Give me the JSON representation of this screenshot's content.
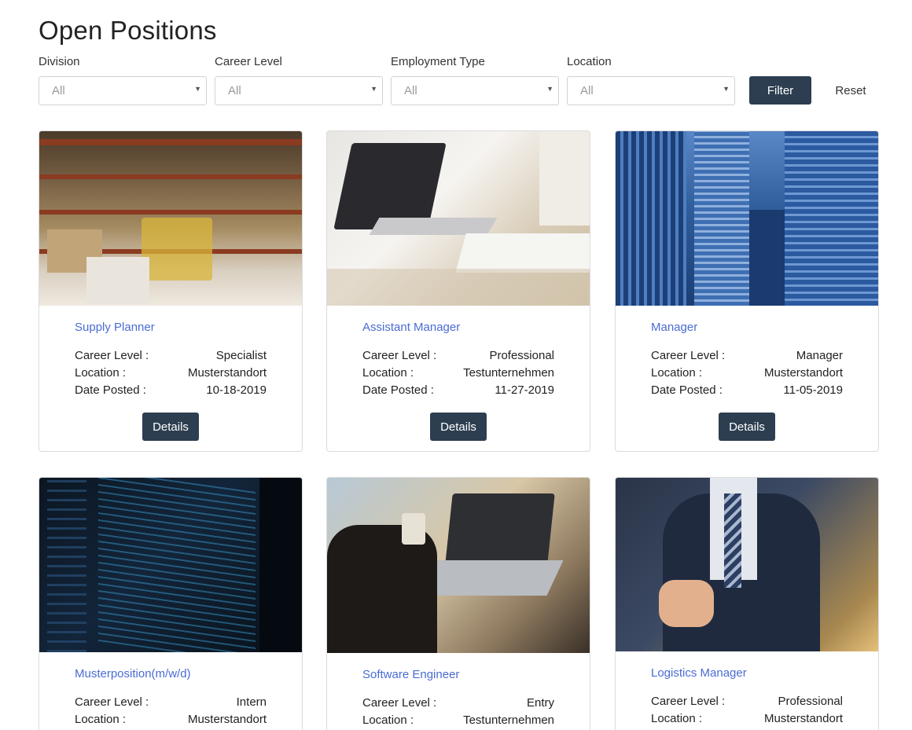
{
  "page_title": "Open Positions",
  "filters": [
    {
      "label": "Division",
      "value": "All"
    },
    {
      "label": "Career Level",
      "value": "All"
    },
    {
      "label": "Employment Type",
      "value": "All"
    },
    {
      "label": "Location",
      "value": "All"
    }
  ],
  "buttons": {
    "filter": "Filter",
    "reset": "Reset",
    "details": "Details"
  },
  "field_labels": {
    "career_level": "Career Level :",
    "location": "Location :",
    "date_posted": "Date Posted :"
  },
  "jobs": [
    {
      "title": "Supply Planner",
      "career_level": "Specialist",
      "location": "Musterstandort",
      "date_posted": "10-18-2019",
      "image": "warehouse-photo"
    },
    {
      "title": "Assistant Manager",
      "career_level": "Professional",
      "location": "Testunternehmen",
      "date_posted": "11-27-2019",
      "image": "laptop-desk-photo"
    },
    {
      "title": "Manager",
      "career_level": "Manager",
      "location": "Musterstandort",
      "date_posted": "11-05-2019",
      "image": "office-buildings-photo"
    },
    {
      "title": "Musterposition(m/w/d)",
      "career_level": "Intern",
      "location": "Musterstandort",
      "image": "code-screen-photo"
    },
    {
      "title": "Software Engineer",
      "career_level": "Entry",
      "location": "Testunternehmen",
      "image": "cafe-laptop-photo"
    },
    {
      "title": "Logistics Manager",
      "career_level": "Professional",
      "location": "Musterstandort",
      "image": "businessman-photo"
    }
  ],
  "colors": {
    "primary_button": "#2c3e50",
    "link": "#4a6cd3",
    "border": "#dcdcdc"
  }
}
